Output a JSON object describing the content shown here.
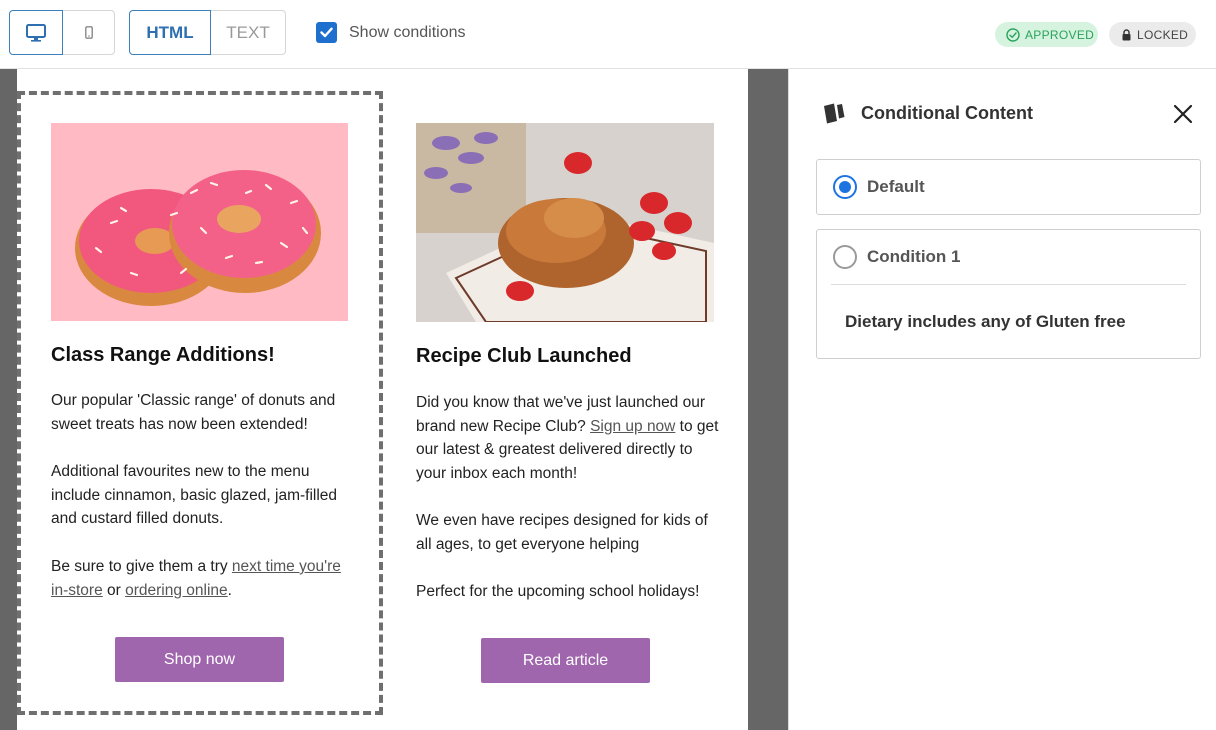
{
  "toolbar": {
    "view_desktop_icon": "desktop-icon",
    "view_mobile_icon": "mobile-icon",
    "format_html_label": "HTML",
    "format_text_label": "TEXT",
    "show_conditions_label": "Show conditions",
    "show_conditions_checked": true,
    "approved_label": "APPROVED",
    "locked_label": "LOCKED",
    "colors": {
      "accent": "#2d6fb0",
      "approved_bg": "#d5f3df",
      "approved_text": "#2aa35a",
      "locked_bg": "#ebebeb"
    }
  },
  "email": {
    "col1": {
      "image_alt": "pink-donuts-image",
      "heading": "Class Range Additions!",
      "p1": "Our popular 'Classic range' of donuts and sweet treats has now been extended!",
      "p2": "Additional favourites new to the menu include cinnamon, basic glazed, jam-filled and custard filled donuts.",
      "p3_pre": "Be sure to give them a try ",
      "p3_link1": "next time you're in-store",
      "p3_mid": " or ",
      "p3_link2": "ordering online",
      "p3_post": ".",
      "cta": "Shop now"
    },
    "col2": {
      "image_alt": "croissant-strawberries-image",
      "heading": "Recipe Club Launched",
      "p1_pre": "Did you know that we've just launched our brand new Recipe Club? ",
      "p1_link": "Sign up now",
      "p1_post": " to get our latest & greatest delivered directly to your inbox each month!",
      "p2": "We even have recipes designed for kids of all ages, to get everyone helping",
      "p3": "Perfect for the upcoming school holidays!",
      "cta": "Read article"
    },
    "colors": {
      "button": "#a066ad",
      "canvas_bg": "#666666"
    }
  },
  "panel": {
    "title": "Conditional Content",
    "options": [
      {
        "label": "Default",
        "selected": true
      },
      {
        "label": "Condition 1",
        "selected": false,
        "rule": "Dietary includes any of Gluten free"
      }
    ],
    "colors": {
      "radio": "#1d74e0"
    }
  }
}
